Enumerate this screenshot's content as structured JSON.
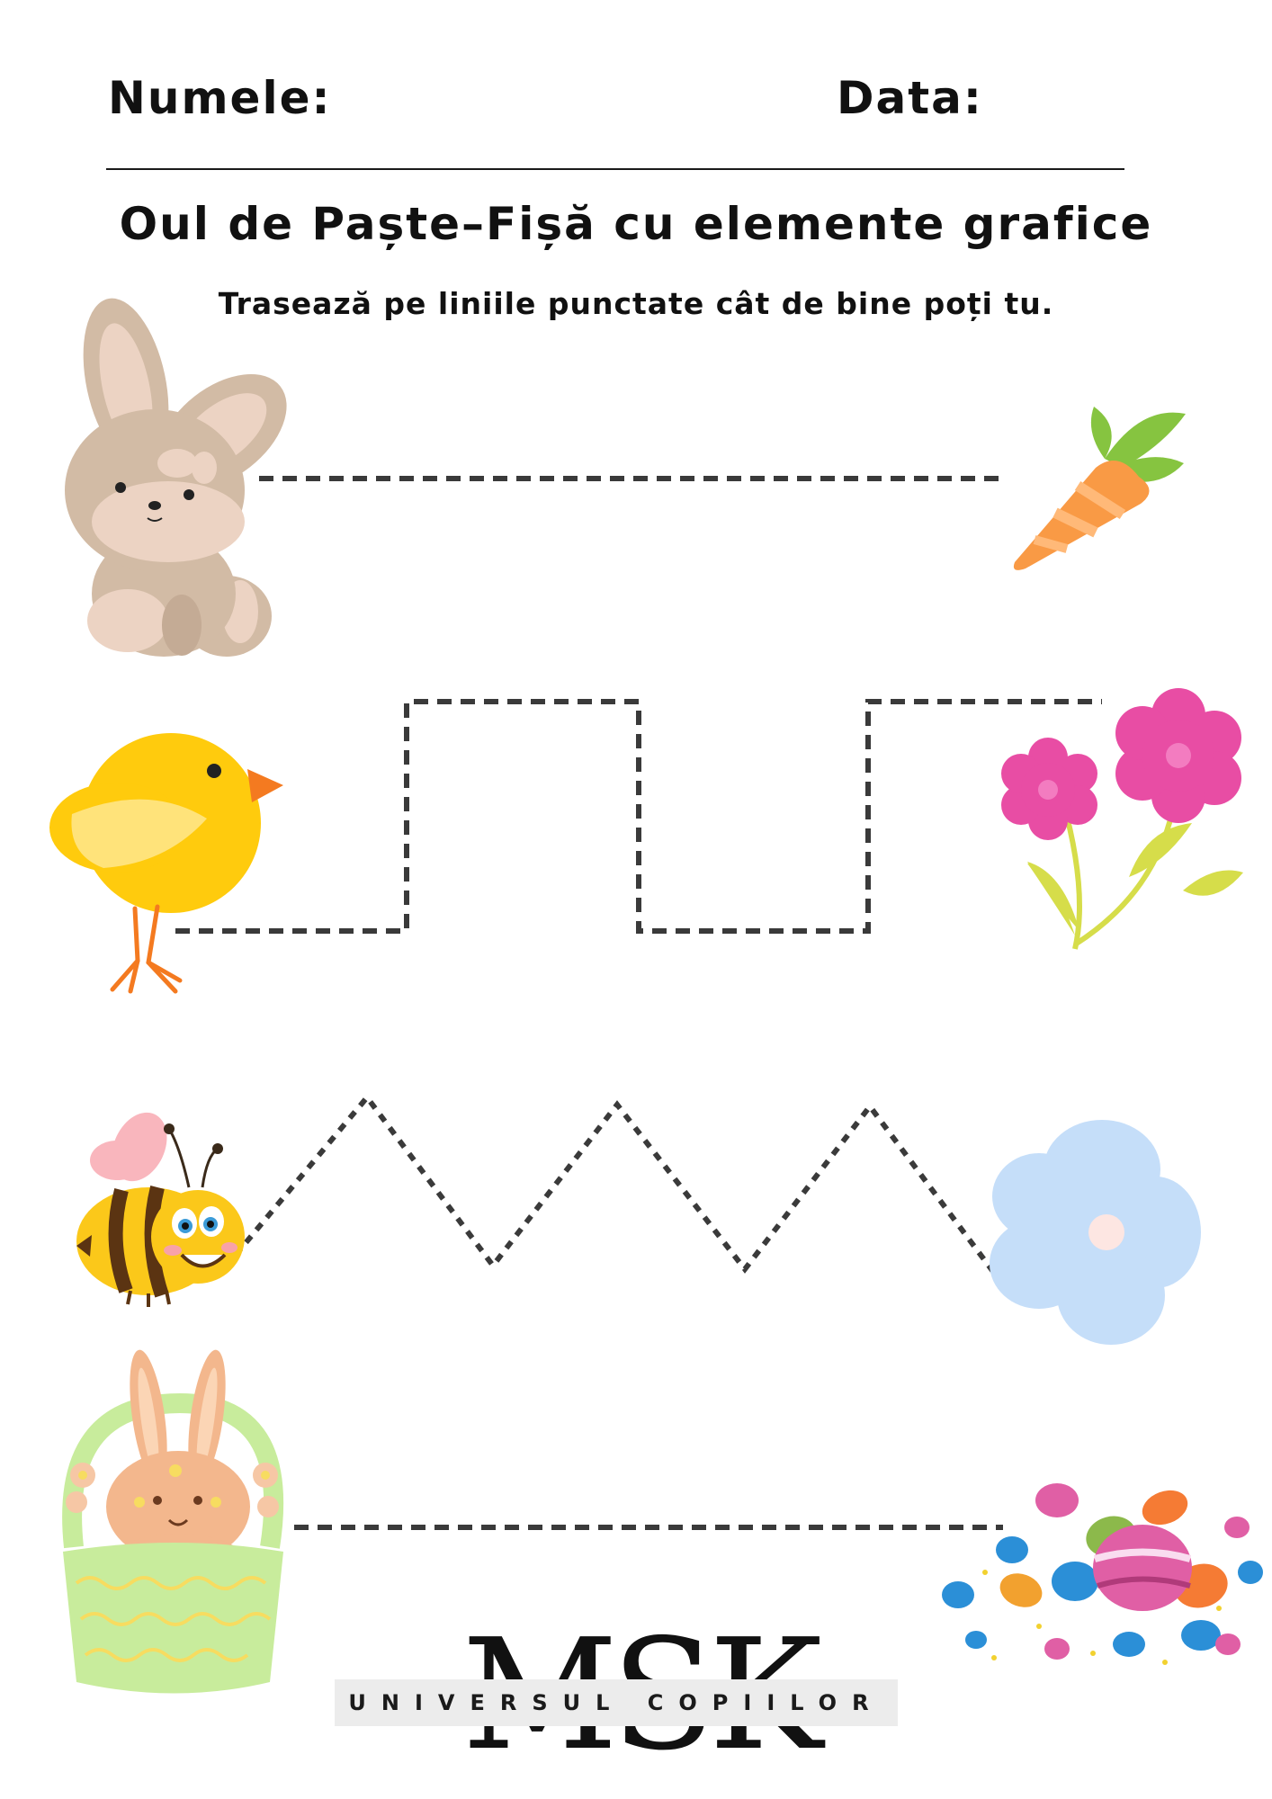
{
  "header": {
    "name_label": "Numele:",
    "date_label": "Data:"
  },
  "title": "Oul de Paște–Fișă cu elemente grafice",
  "instructions": "Trasează pe liniile punctate cât de bine poți tu.",
  "logo": {
    "mark": "MSK",
    "subtitle": "UNIVERSUL COPIILOR"
  },
  "rows": [
    {
      "start": "bunny-icon",
      "end": "carrot-icon",
      "path": "straight-dashed-line"
    },
    {
      "start": "chick-icon",
      "end": "pink-flowers-icon",
      "path": "square-wave-dashed-line"
    },
    {
      "start": "bee-icon",
      "end": "blue-flower-icon",
      "path": "zigzag-dashed-line"
    },
    {
      "start": "bunny-basket-icon",
      "end": "easter-eggs-icon",
      "path": "straight-dashed-line"
    }
  ],
  "colors": {
    "path_stroke": "#3a3a3a",
    "bunny": "#d2bba5",
    "chick": "#ffcb0d",
    "carrot": "#f99a45",
    "pink_flower": "#e84da4",
    "blue_flower": "#c5def9",
    "basket": "#c8ec9c"
  }
}
